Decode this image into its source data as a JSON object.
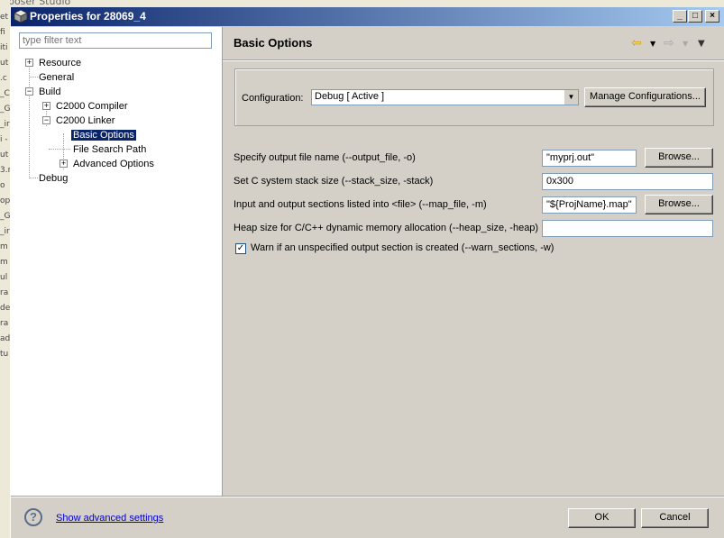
{
  "background": {
    "top_text": "nposer Studio",
    "left_fragments": [
      "et",
      "fi",
      "iti",
      "ut",
      ".c",
      "_C",
      "_G",
      "_ir",
      "i -",
      "ut",
      "3.r",
      "o",
      "op",
      "_G",
      "_ir",
      "m",
      "m",
      "ul",
      "ra",
      "de",
      "ra",
      "ad",
      "tu"
    ]
  },
  "window": {
    "title": "Properties for 28069_4"
  },
  "filter": {
    "placeholder": "type filter text"
  },
  "tree": {
    "resource": "Resource",
    "general": "General",
    "build": "Build",
    "compiler": "C2000 Compiler",
    "linker": "C2000 Linker",
    "basic_options": "Basic Options",
    "file_search_path": "File Search Path",
    "advanced_options": "Advanced Options",
    "debug": "Debug"
  },
  "page": {
    "title": "Basic Options"
  },
  "configuration": {
    "label": "Configuration:",
    "value": "Debug  [ Active ]",
    "manage_label": "Manage Configurations..."
  },
  "options": {
    "output_file_label": "Specify output file name (--output_file, -o)",
    "output_file_value": "\"myprj.out\"",
    "stack_size_label": "Set C system stack size (--stack_size, -stack)",
    "stack_size_value": "0x300",
    "map_file_label": "Input and output sections listed into <file> (--map_file, -m)",
    "map_file_value": "\"${ProjName}.map\"",
    "heap_size_label": "Heap size for C/C++ dynamic memory allocation (--heap_size, -heap)",
    "heap_size_value": "",
    "warn_label": "Warn if an unspecified output section is created (--warn_sections, -w)",
    "warn_checked": true,
    "browse_label": "Browse..."
  },
  "footer": {
    "advanced_link": "Show advanced settings",
    "ok_label": "OK",
    "cancel_label": "Cancel"
  }
}
